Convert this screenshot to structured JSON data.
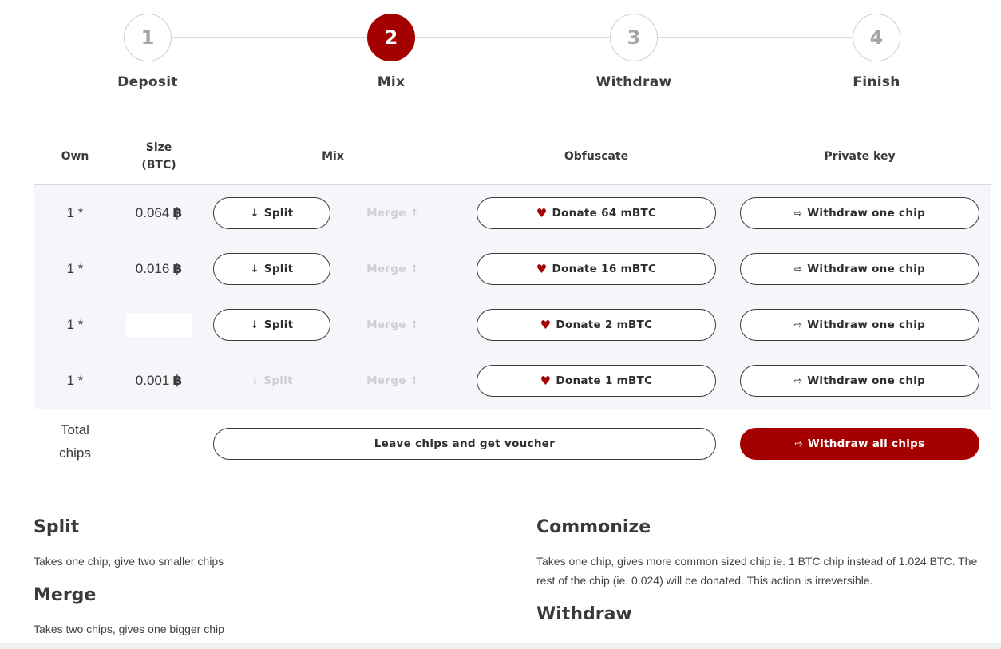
{
  "steps": [
    {
      "number": "1",
      "label": "Deposit"
    },
    {
      "number": "2",
      "label": "Mix"
    },
    {
      "number": "3",
      "label": "Withdraw"
    },
    {
      "number": "4",
      "label": "Finish"
    }
  ],
  "active_step": "2",
  "table": {
    "headers": {
      "own": "Own",
      "size_line1": "Size",
      "size_line2": "(BTC)",
      "mix": "Mix",
      "obfuscate": "Obfuscate",
      "private_key": "Private key"
    },
    "rows": [
      {
        "own": "1 *",
        "size": "0.064",
        "split": "Split",
        "split_enabled": true,
        "merge": "Merge",
        "donate": "Donate 64 mBTC",
        "withdraw": "Withdraw one chip"
      },
      {
        "own": "1 *",
        "size": "0.016",
        "split": "Split",
        "split_enabled": true,
        "merge": "Merge",
        "donate": "Donate 16 mBTC",
        "withdraw": "Withdraw one chip"
      },
      {
        "own": "1 *",
        "size": "",
        "split": "Split",
        "split_enabled": true,
        "merge": "Merge",
        "donate": "Donate 2 mBTC",
        "withdraw": "Withdraw one chip"
      },
      {
        "own": "1 *",
        "size": "0.001",
        "split": "Split",
        "split_enabled": false,
        "merge": "Merge",
        "donate": "Donate 1 mBTC",
        "withdraw": "Withdraw one chip"
      }
    ],
    "btc_symbol": "฿",
    "total_line1": "Total",
    "total_line2": "chips",
    "voucher_button": "Leave chips and get voucher",
    "withdraw_all_button": "Withdraw all chips"
  },
  "help": {
    "split_title": "Split",
    "split_text": "Takes one chip, give two smaller chips",
    "merge_title": "Merge",
    "merge_text": "Takes two chips, gives one bigger chip",
    "commonize_title": "Commonize",
    "commonize_text": "Takes one chip, gives more common sized chip ie. 1 BTC chip instead of 1.024 BTC. The rest of the chip (ie. 0.024) will be donated. This action is irreversible.",
    "withdraw_title": "Withdraw"
  },
  "colors": {
    "accent": "#a50000",
    "table_bg": "#f5f5fa",
    "disabled": "#cfcfd6"
  },
  "icons": {
    "split": "arrow-down-icon",
    "merge": "arrow-up-icon",
    "donate": "heart-icon",
    "withdraw": "sign-out-icon"
  }
}
